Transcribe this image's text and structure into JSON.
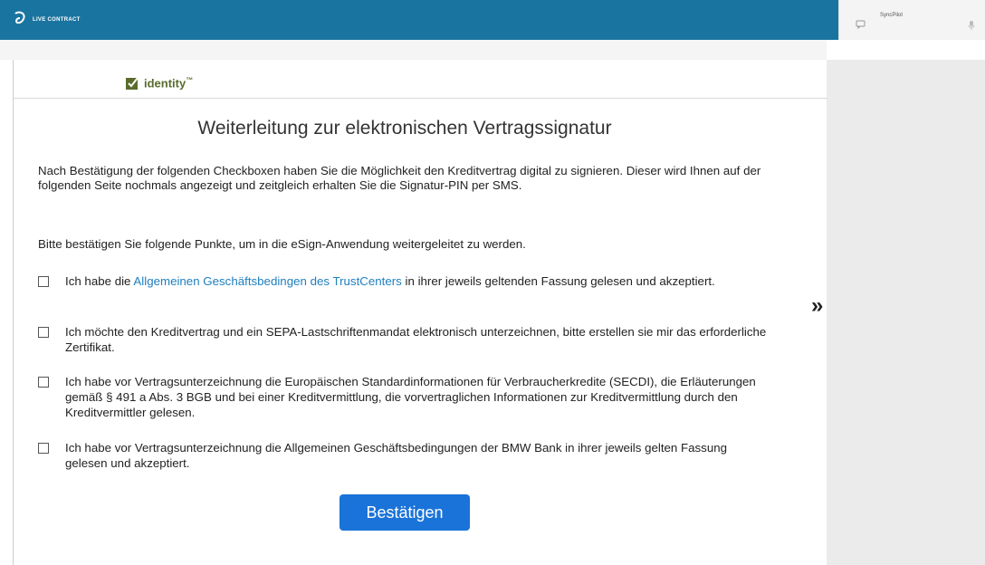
{
  "header": {
    "brand": "LIVE CONTRACT"
  },
  "right_header": {
    "label": "SyncPilot"
  },
  "content": {
    "identity": {
      "name": "identity",
      "tm": "™"
    },
    "title": "Weiterleitung zur elektronischen Vertragssignatur",
    "intro": "Nach Bestätigung der folgenden Checkboxen haben Sie die Möglichkeit den Kreditvertrag digital zu signieren. Dieser wird Ihnen auf der folgenden Seite nochmals angezeigt und zeitgleich erhalten Sie die Signatur-PIN per SMS.",
    "prompt": "Bitte bestätigen Sie folgende Punkte, um in die eSign-Anwendung weitergeleitet zu werden.",
    "checks": [
      {
        "pre": "Ich habe die ",
        "link": "Allgemeinen Geschäftsbedingen des TrustCenters",
        "post": " in ihrer jeweils geltenden Fassung gelesen und akzeptiert."
      },
      {
        "text": "Ich möchte den Kreditvertrag und ein SEPA-Lastschriftenmandat elektronisch unterzeichnen, bitte erstellen sie mir das erforderliche Zertifikat."
      },
      {
        "text": "Ich habe vor Vertragsunterzeichnung die Europäischen Standardinformationen für Verbraucherkredite (SECDI), die Erläuterungen gemäß § 491 a Abs. 3 BGB und bei einer Kreditvermittlung, die vorvertraglichen Informationen zur Kreditvermittlung durch den Kreditvermittler gelesen."
      },
      {
        "text": "Ich habe vor Vertragsunterzeichnung die Allgemeinen Geschäftsbedingungen der BMW Bank in ihrer jeweils gelten Fassung gelesen und akzeptiert."
      }
    ],
    "confirm_label": "Bestätigen"
  },
  "side": {
    "expand_glyph": "»"
  },
  "colors": {
    "header": "#1a74a0",
    "button": "#1a73d9",
    "link": "#1e7fbf",
    "brand_green": "#5a6b2c"
  }
}
